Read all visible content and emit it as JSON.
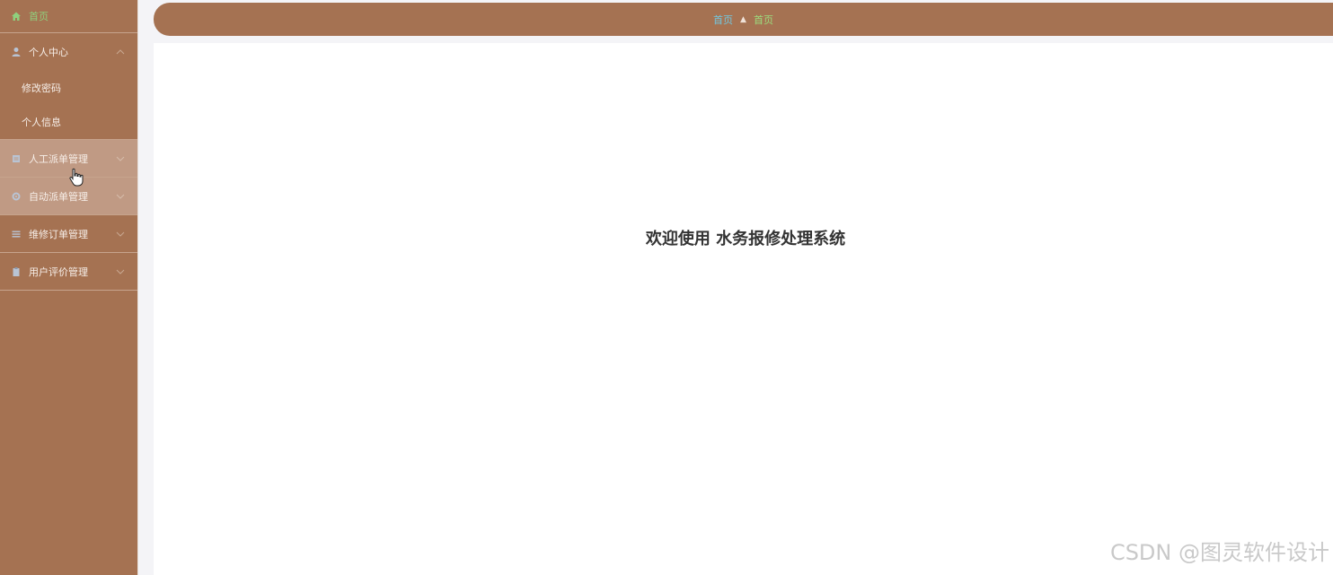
{
  "sidebar": {
    "home": {
      "label": "首页",
      "icon": "home-icon"
    },
    "personal_center": {
      "label": "个人中心",
      "icon": "user-icon",
      "items": [
        "修改密码",
        "个人信息"
      ]
    },
    "menus": [
      {
        "label": "人工派单管理",
        "icon": "document-icon"
      },
      {
        "label": "自动派单管理",
        "icon": "gear-icon"
      },
      {
        "label": "维修订单管理",
        "icon": "list-icon"
      },
      {
        "label": "用户评价管理",
        "icon": "clipboard-icon"
      }
    ]
  },
  "breadcrumb": {
    "home": "首页",
    "separator": "▲",
    "current": "首页"
  },
  "main": {
    "welcome": "欢迎使用 水务报修处理系统"
  },
  "watermark": "CSDN @图灵软件设计",
  "colors": {
    "sidebar_bg": "#a57252",
    "topbar_bg": "#a57252",
    "home_active": "#8fd07d",
    "breadcrumb_link": "#72c7df",
    "breadcrumb_current": "#9bdc7e"
  }
}
